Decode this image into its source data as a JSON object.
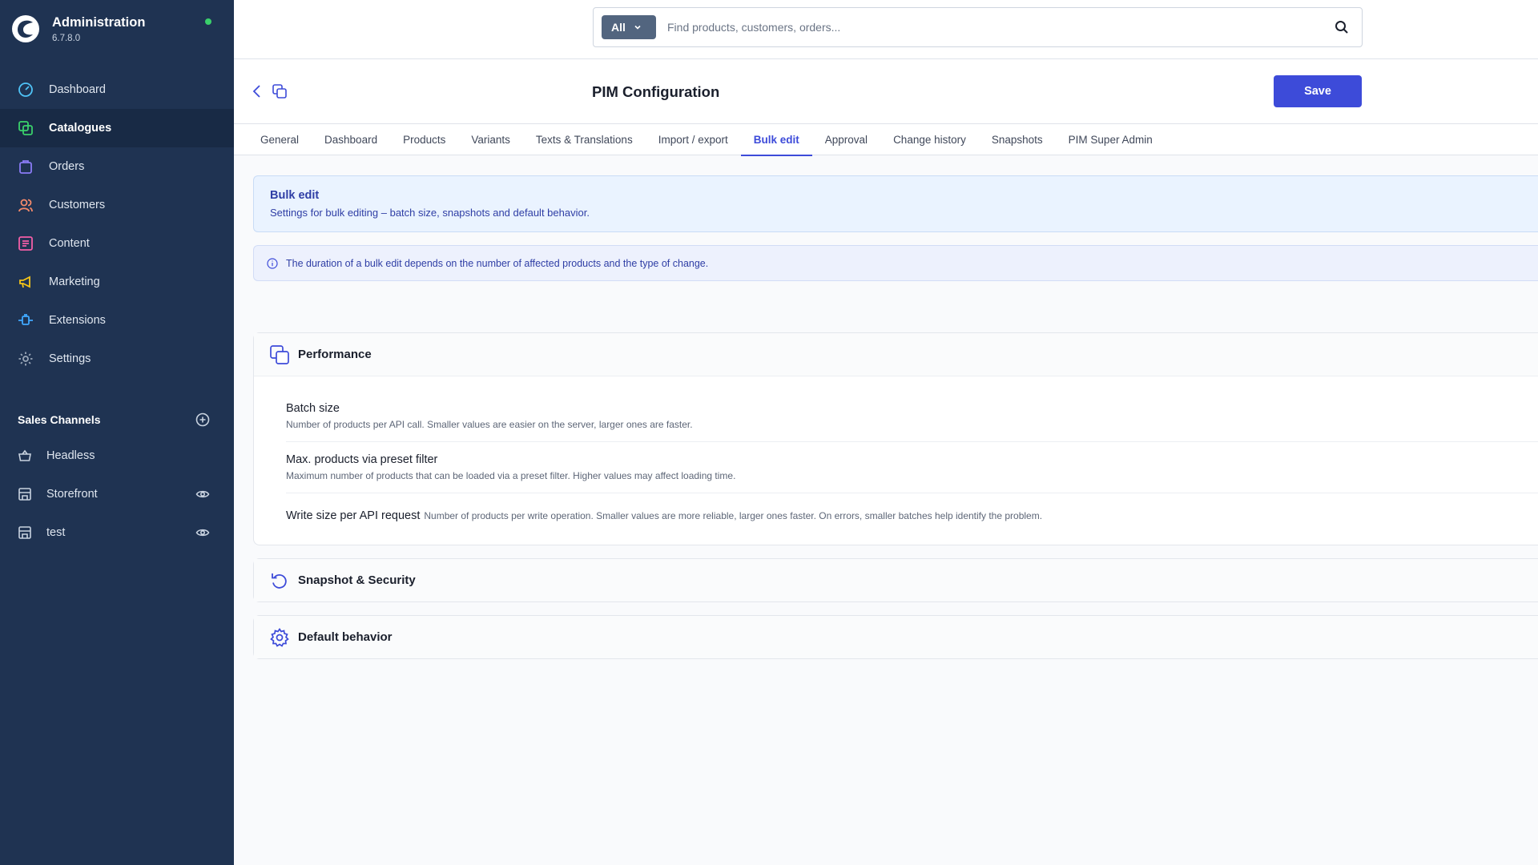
{
  "app": {
    "title": "Administration",
    "version": "6.7.8.0",
    "status_color": "#3ad06b",
    "accent_color": "#3d4bd9"
  },
  "nav": {
    "items": [
      {
        "label": "Dashboard",
        "icon": "dashboard-gauge-icon",
        "color": "#4fc3f7"
      },
      {
        "label": "Catalogues",
        "icon": "catalogue-icon",
        "color": "#3ad06b",
        "active": true
      },
      {
        "label": "Orders",
        "icon": "shopping-bag-icon",
        "color": "#8b7cf6"
      },
      {
        "label": "Customers",
        "icon": "users-icon",
        "color": "#f58a6b"
      },
      {
        "label": "Content",
        "icon": "content-list-icon",
        "color": "#f25ea6"
      },
      {
        "label": "Marketing",
        "icon": "megaphone-icon",
        "color": "#f5c518"
      },
      {
        "label": "Extensions",
        "icon": "plug-icon",
        "color": "#40a9ff"
      },
      {
        "label": "Settings",
        "icon": "gear-icon",
        "color": "#9aa7b8"
      }
    ]
  },
  "sales_channels": {
    "title": "Sales Channels",
    "items": [
      {
        "label": "Headless",
        "icon": "basket-icon"
      },
      {
        "label": "Storefront",
        "icon": "store-icon",
        "visible_toggle": "eye-icon"
      },
      {
        "label": "test",
        "icon": "store-icon",
        "visible_toggle": "eye-icon"
      }
    ]
  },
  "search": {
    "type_label": "All",
    "placeholder": "Find products, customers, orders..."
  },
  "page": {
    "title": "PIM Configuration",
    "save_label": "Save"
  },
  "tabs": [
    {
      "label": "General"
    },
    {
      "label": "Dashboard"
    },
    {
      "label": "Products"
    },
    {
      "label": "Variants"
    },
    {
      "label": "Texts & Translations"
    },
    {
      "label": "Import / export"
    },
    {
      "label": "Bulk edit",
      "active": true
    },
    {
      "label": "Approval"
    },
    {
      "label": "Change history"
    },
    {
      "label": "Snapshots"
    },
    {
      "label": "PIM Super Admin"
    }
  ],
  "intro": {
    "title": "Bulk edit",
    "description": "Settings for bulk editing – batch size, snapshots and default behavior."
  },
  "notice": {
    "text": "The duration of a bulk edit depends on the number of affected products and the type of change."
  },
  "panels": {
    "performance": {
      "title": "Performance",
      "icon": "copy-stack-icon",
      "settings": [
        {
          "label": "Batch size",
          "description": "Number of products per API call. Smaller values are easier on the server, larger ones are faster."
        },
        {
          "label": "Max. products via preset filter",
          "description": "Maximum number of products that can be loaded via a preset filter. Higher values may affect loading time."
        },
        {
          "label": "Write size per API request",
          "description": "Number of products per write operation. Smaller values are more reliable, larger ones faster. On errors, smaller batches help identify the problem."
        }
      ]
    },
    "snapshot": {
      "title": "Snapshot & Security",
      "icon": "undo-arrow-icon"
    },
    "default_behavior": {
      "title": "Default behavior",
      "icon": "cog-icon"
    }
  }
}
